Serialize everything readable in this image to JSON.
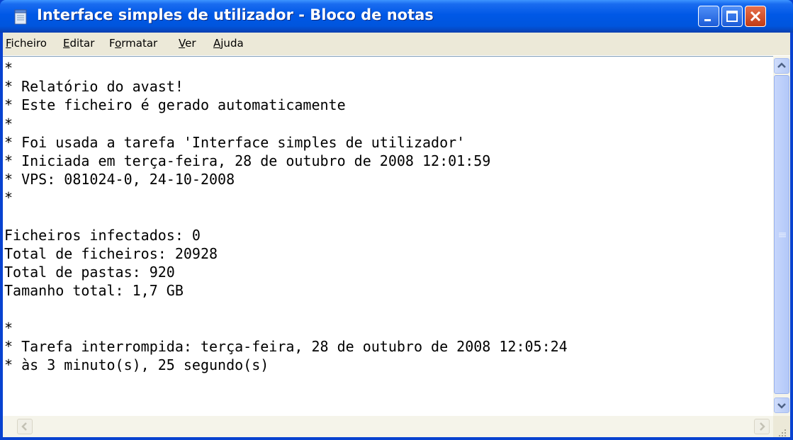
{
  "window": {
    "title": "Interface simples de utilizador - Bloco de notas"
  },
  "menu": {
    "items": [
      {
        "accel": "F",
        "rest": "icheiro"
      },
      {
        "accel": "E",
        "rest": "ditar"
      },
      {
        "pre": "F",
        "accel": "o",
        "rest": "rmatar"
      },
      {
        "accel": "V",
        "rest": "er"
      },
      {
        "accel": "A",
        "rest": "juda"
      }
    ]
  },
  "editor": {
    "lines": [
      "*",
      "* Relatório do avast!",
      "* Este ficheiro é gerado automaticamente",
      "*",
      "* Foi usada a tarefa 'Interface simples de utilizador'",
      "* Iniciada em terça-feira, 28 de outubro de 2008 12:01:59",
      "* VPS: 081024-0, 24-10-2008",
      "*",
      "",
      "Ficheiros infectados: 0",
      "Total de ficheiros: 20928",
      "Total de pastas: 920",
      "Tamanho total: 1,7 GB",
      "",
      "*",
      "* Tarefa interrompida: terça-feira, 28 de outubro de 2008 12:05:24",
      "* às 3 minuto(s), 25 segundo(s)"
    ]
  },
  "icons": {
    "app": "notepad-icon",
    "minimize": "minimize-icon",
    "maximize": "maximize-icon",
    "close": "close-icon"
  },
  "colors": {
    "titlebar": "#0058e6",
    "close_button": "#c13b15",
    "menubar": "#ece9d8",
    "editor_bg": "#ffffff",
    "scrollbar": "#b7cbf7"
  }
}
